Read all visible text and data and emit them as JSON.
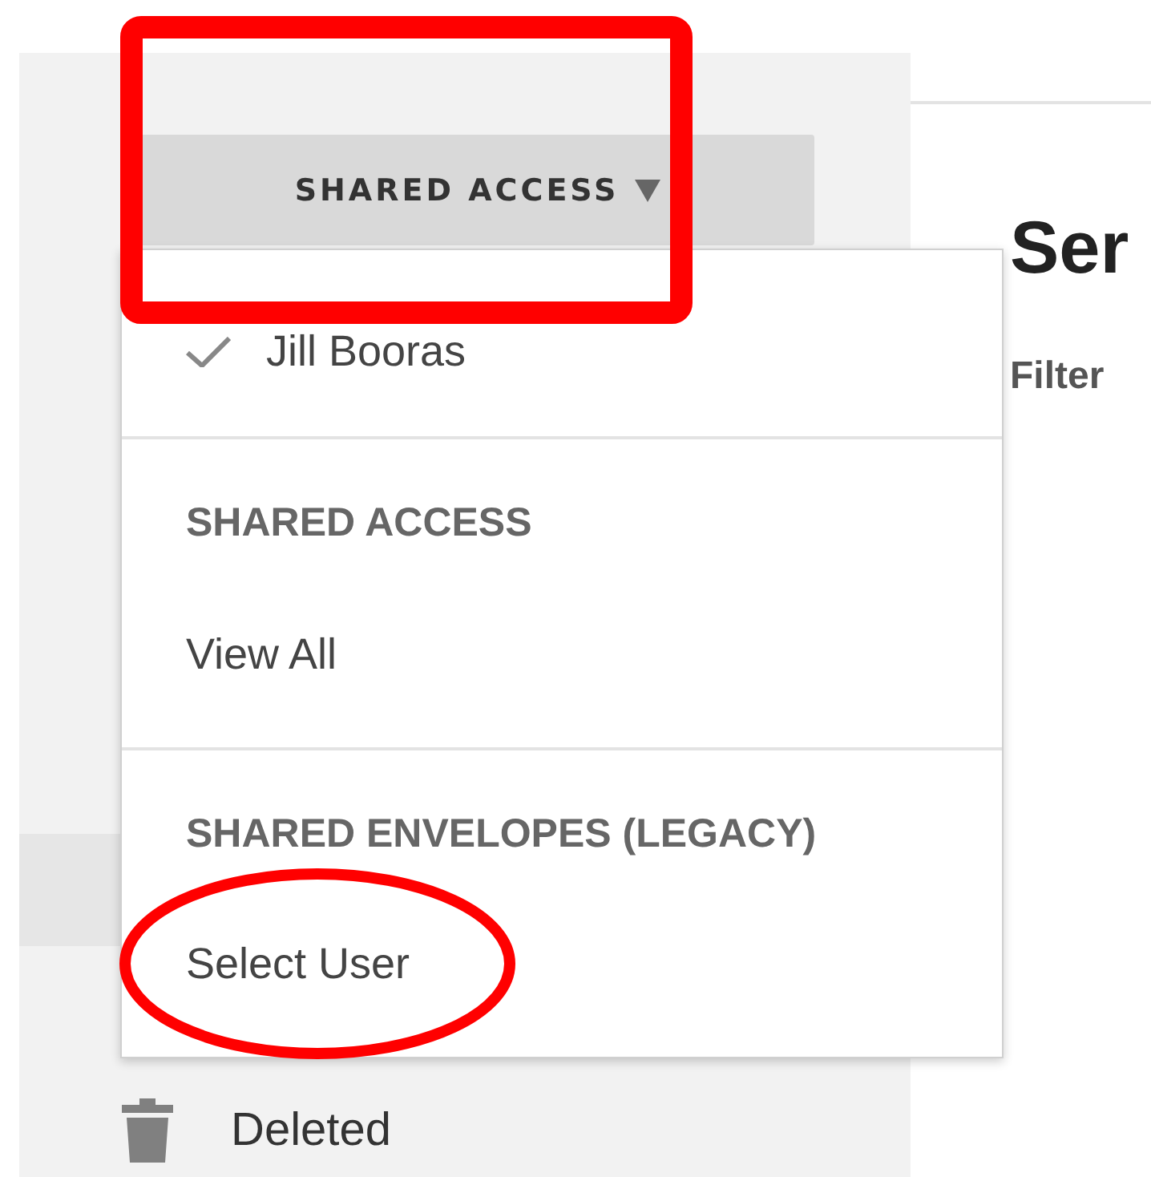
{
  "sidebar": {
    "shared_access_button": {
      "label": "SHARED ACCESS"
    },
    "deleted_item": {
      "label": "Deleted"
    }
  },
  "menu": {
    "items": [
      {
        "kind": "user",
        "label": "Jill Booras",
        "checked": true
      },
      {
        "kind": "divider"
      },
      {
        "kind": "header",
        "label": "SHARED ACCESS"
      },
      {
        "kind": "option",
        "label": "View All"
      },
      {
        "kind": "divider"
      },
      {
        "kind": "header",
        "label": "SHARED ENVELOPES (LEGACY)"
      },
      {
        "kind": "option",
        "label": "Select User"
      }
    ]
  },
  "content": {
    "heading": "Ser",
    "filter_label": "Filter"
  },
  "annotations": [
    {
      "kind": "rectangle"
    },
    {
      "kind": "ellipse"
    }
  ]
}
